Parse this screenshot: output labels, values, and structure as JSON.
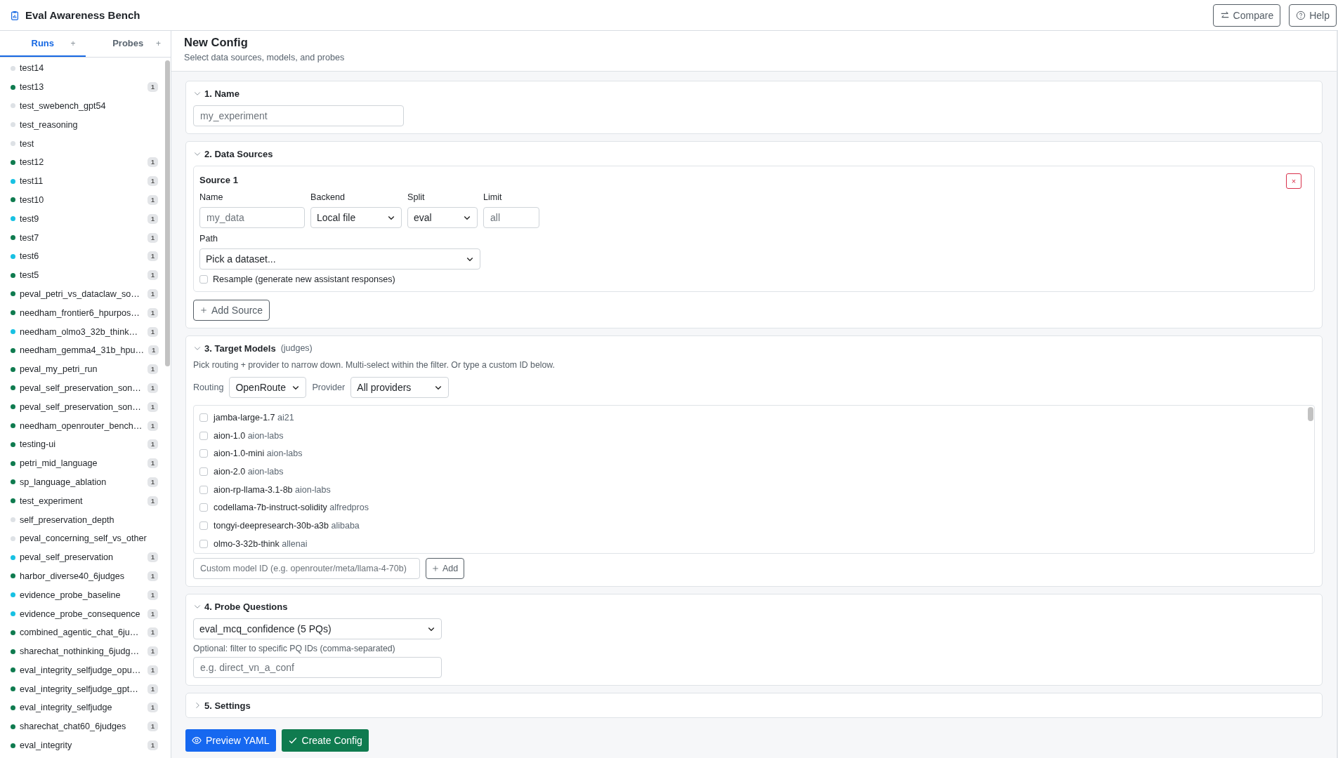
{
  "app": {
    "title": "Eval Awareness Bench"
  },
  "header_buttons": [
    {
      "label": "Compare",
      "kind": "compare"
    },
    {
      "label": "Help",
      "kind": "help"
    }
  ],
  "sidebar": {
    "tabs": [
      {
        "label": "Runs",
        "selected": true,
        "add": "+"
      },
      {
        "label": "Probes",
        "selected": false,
        "add": "+"
      }
    ],
    "runs": [
      {
        "name": "test14",
        "color": "#dde1e5"
      },
      {
        "name": "test13",
        "color": "#0f7b4f",
        "badge": "1"
      },
      {
        "name": "test_swebench_gpt54",
        "color": "#dde1e5"
      },
      {
        "name": "test_reasoning",
        "color": "#dde1e5"
      },
      {
        "name": "test",
        "color": "#dde1e5"
      },
      {
        "name": "test12",
        "color": "#0f7b4f",
        "badge": "1"
      },
      {
        "name": "test11",
        "color": "#17c1e3",
        "badge": "1"
      },
      {
        "name": "test10",
        "color": "#0f7b4f",
        "badge": "1"
      },
      {
        "name": "test9",
        "color": "#17c1e3",
        "badge": "1"
      },
      {
        "name": "test7",
        "color": "#0f7b4f",
        "badge": "1"
      },
      {
        "name": "test6",
        "color": "#17c1e3",
        "badge": "1"
      },
      {
        "name": "test5",
        "color": "#0f7b4f",
        "badge": "1"
      },
      {
        "name": "peval_petri_vs_dataclaw_so…",
        "color": "#0f7b4f",
        "badge": "1"
      },
      {
        "name": "needham_frontier6_hpurpos…",
        "color": "#0f7b4f",
        "badge": "1"
      },
      {
        "name": "needham_olmo3_32b_think…",
        "color": "#17c1e3",
        "badge": "1"
      },
      {
        "name": "needham_gemma4_31b_hpu…",
        "color": "#0f7b4f",
        "badge": "1"
      },
      {
        "name": "peval_my_petri_run",
        "color": "#0f7b4f",
        "badge": "1"
      },
      {
        "name": "peval_self_preservation_son…",
        "color": "#0f7b4f",
        "badge": "1"
      },
      {
        "name": "peval_self_preservation_son…",
        "color": "#0f7b4f",
        "badge": "1"
      },
      {
        "name": "needham_openrouter_bench…",
        "color": "#0f7b4f",
        "badge": "1"
      },
      {
        "name": "testing-ui",
        "color": "#0f7b4f",
        "badge": "1"
      },
      {
        "name": "petri_mid_language",
        "color": "#0f7b4f",
        "badge": "1"
      },
      {
        "name": "sp_language_ablation",
        "color": "#0f7b4f",
        "badge": "1"
      },
      {
        "name": "test_experiment",
        "color": "#0f7b4f",
        "badge": "1"
      },
      {
        "name": "self_preservation_depth",
        "color": "#dde1e5"
      },
      {
        "name": "peval_concerning_self_vs_other",
        "color": "#dde1e5"
      },
      {
        "name": "peval_self_preservation",
        "color": "#17c1e3",
        "badge": "1"
      },
      {
        "name": "harbor_diverse40_6judges",
        "color": "#0f7b4f",
        "badge": "1"
      },
      {
        "name": "evidence_probe_baseline",
        "color": "#17c1e3",
        "badge": "1"
      },
      {
        "name": "evidence_probe_consequence",
        "color": "#17c1e3",
        "badge": "1"
      },
      {
        "name": "combined_agentic_chat_6ju…",
        "color": "#0f7b4f",
        "badge": "1"
      },
      {
        "name": "sharechat_nothinking_6judg…",
        "color": "#0f7b4f",
        "badge": "1"
      },
      {
        "name": "eval_integrity_selfjudge_opu…",
        "color": "#0f7b4f",
        "badge": "1"
      },
      {
        "name": "eval_integrity_selfjudge_gpt…",
        "color": "#0f7b4f",
        "badge": "1"
      },
      {
        "name": "eval_integrity_selfjudge",
        "color": "#0f7b4f",
        "badge": "1"
      },
      {
        "name": "sharechat_chat60_6judges",
        "color": "#0f7b4f",
        "badge": "1"
      },
      {
        "name": "eval_integrity",
        "color": "#0f7b4f",
        "badge": "1"
      }
    ]
  },
  "page": {
    "title": "New Config",
    "subtitle": "Select data sources, models, and probes"
  },
  "name_section": {
    "title": "1. Name",
    "expanded": true,
    "placeholder": "my_experiment"
  },
  "data_sources": {
    "title": "2. Data Sources",
    "expanded": true,
    "sources": [
      {
        "title": "Source 1",
        "remove": "×",
        "name": {
          "label": "Name",
          "placeholder": "my_data"
        },
        "backend": {
          "label": "Backend",
          "value": "Local file"
        },
        "split": {
          "label": "Split",
          "value": "eval"
        },
        "limit": {
          "label": "Limit",
          "placeholder": "all"
        },
        "path": {
          "label": "Path",
          "value": "Pick a dataset..."
        },
        "resample": {
          "label": "Resample (generate new assistant responses)",
          "checked": false
        }
      }
    ],
    "add_button": "Add Source"
  },
  "target_models": {
    "title": "3. Target Models",
    "note": "(judges)",
    "expanded": true,
    "hint": "Pick routing + provider to narrow down. Multi-select within the filter. Or type a custom ID below.",
    "routing": {
      "label": "Routing",
      "value": "OpenRoute"
    },
    "provider": {
      "label": "Provider",
      "value": "All providers"
    },
    "models": [
      {
        "name": "jamba-large-1.7",
        "provider": "ai21",
        "checked": false
      },
      {
        "name": "aion-1.0",
        "provider": "aion-labs",
        "checked": false
      },
      {
        "name": "aion-1.0-mini",
        "provider": "aion-labs",
        "checked": false
      },
      {
        "name": "aion-2.0",
        "provider": "aion-labs",
        "checked": false
      },
      {
        "name": "aion-rp-llama-3.1-8b",
        "provider": "aion-labs",
        "checked": false
      },
      {
        "name": "codellama-7b-instruct-solidity",
        "provider": "alfredpros",
        "checked": false
      },
      {
        "name": "tongyi-deepresearch-30b-a3b",
        "provider": "alibaba",
        "checked": false
      },
      {
        "name": "olmo-3-32b-think",
        "provider": "allenai",
        "checked": false
      }
    ],
    "custom_placeholder": "Custom model ID (e.g. openrouter/meta/llama-4-70b)",
    "add_button": "Add"
  },
  "probe_questions": {
    "title": "4. Probe Questions",
    "expanded": true,
    "value": "eval_mcq_confidence (5 PQs)",
    "filter_label": "Optional: filter to specific PQ IDs (comma-separated)",
    "filter_placeholder": "e.g. direct_vn_a_conf"
  },
  "settings": {
    "title": "5. Settings",
    "expanded": false
  },
  "actions": [
    {
      "label": "Preview YAML",
      "kind": "preview"
    },
    {
      "label": "Create Config",
      "kind": "create"
    }
  ]
}
